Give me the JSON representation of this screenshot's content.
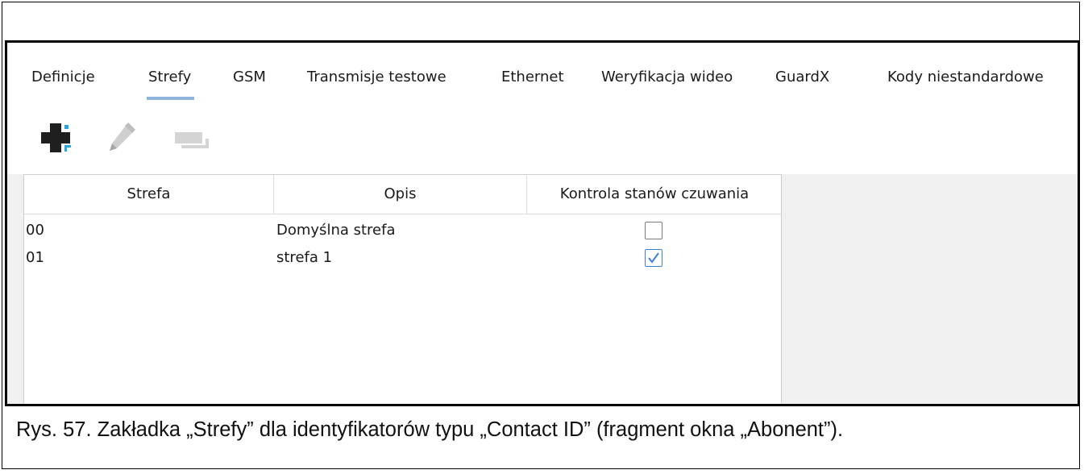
{
  "tabs": [
    {
      "label": "Definicje",
      "active": false
    },
    {
      "label": "Strefy",
      "active": true
    },
    {
      "label": "GSM",
      "active": false
    },
    {
      "label": "Transmisje testowe",
      "active": false
    },
    {
      "label": "Ethernet",
      "active": false
    },
    {
      "label": "Weryfikacja wideo",
      "active": false
    },
    {
      "label": "GuardX",
      "active": false
    },
    {
      "label": "Kody niestandardowe",
      "active": false
    }
  ],
  "toolbar": {
    "add_icon": "plus-add-icon",
    "edit_icon": "pencil-icon",
    "delete_icon": "remove-icon"
  },
  "table": {
    "columns": [
      "Strefa",
      "Opis",
      "Kontrola stanów czuwania"
    ],
    "rows": [
      {
        "strefa": "00",
        "opis": "Domyślna strefa",
        "kontrola": false
      },
      {
        "strefa": "01",
        "opis": "strefa 1",
        "kontrola": true
      }
    ]
  },
  "caption": "Rys. 57. Zakładka „Strefy” dla identyfikatorów typu „Contact ID” (fragment okna „Abonent”).",
  "colors": {
    "accent": "#8fb4dd",
    "check": "#3d7fd8",
    "add_corner": "#2aa7e0"
  }
}
